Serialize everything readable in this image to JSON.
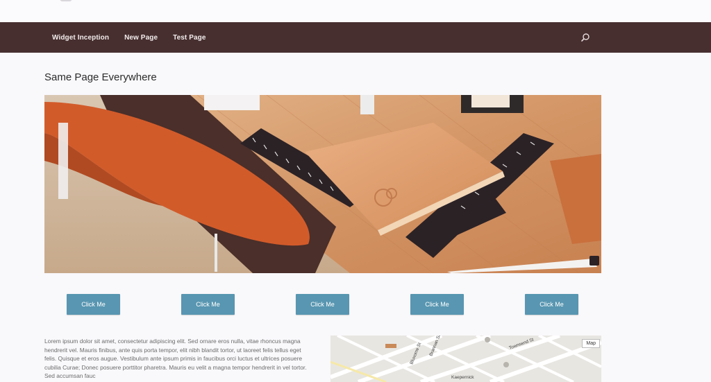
{
  "header": {
    "nav": [
      "Widget Inception",
      "New Page",
      "Test Page"
    ]
  },
  "main": {
    "title": "Same Page Everywhere",
    "buttons": [
      "Click Me",
      "Click Me",
      "Click Me",
      "Click Me",
      "Click Me"
    ],
    "body_text": "Lorem ipsum dolor sit amet, consectetur adipiscing elit. Sed ornare eros nulla, vitae rhoncus magna hendrerit vel. Mauris finibus, ante quis porta tempor, elit nibh blandit tortor, ut laoreet felis tellus eget felis. Quisque et eros augue. Vestibulum ante ipsum primis in faucibus orci luctus et ultrices posuere cubilia Curae; Donec posuere porttitor pharetra. Mauris eu velit a magna tempor hendrerit in vel tortor. Sed accumsan fauc"
  },
  "map": {
    "badge": "Map",
    "labels": [
      "Bluxome St",
      "Brannan St",
      "Townsend St",
      "Kaepernick"
    ]
  },
  "colors": {
    "navbar": "#472f30",
    "button": "#5896b1",
    "page_bg": "#f9f8fb"
  }
}
